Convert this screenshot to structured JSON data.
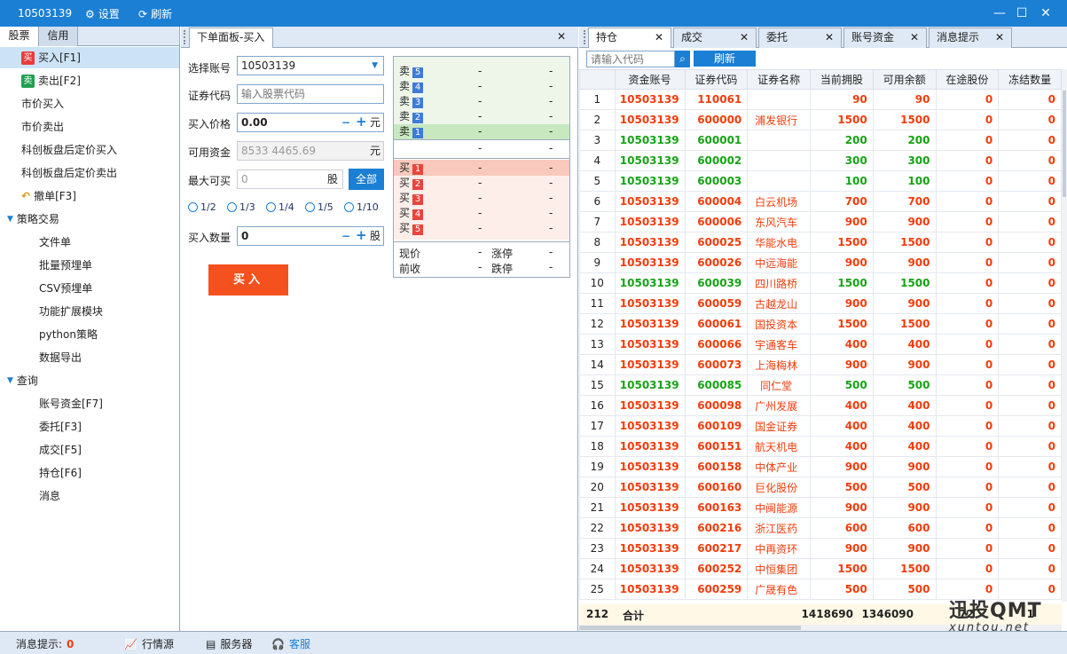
{
  "title": {
    "account": "10503139",
    "settings": "设置",
    "refresh": "刷新"
  },
  "left": {
    "tabs": [
      "股票",
      "信用"
    ],
    "items": [
      {
        "label": "买入[F1]",
        "badge": "买",
        "badge_color": "#e83c3c",
        "level": 1,
        "selected": true
      },
      {
        "label": "卖出[F2]",
        "badge": "卖",
        "badge_color": "#20a050",
        "level": 1
      },
      {
        "label": "市价买入",
        "level": 0
      },
      {
        "label": "市价卖出",
        "level": 0
      },
      {
        "label": "科创板盘后定价买入",
        "level": 0
      },
      {
        "label": "科创板盘后定价卖出",
        "level": 0
      },
      {
        "label": "撤单[F3]",
        "icon": "undo-icon",
        "level": 1
      },
      {
        "label": "策略交易",
        "caret": true,
        "level": 0
      },
      {
        "label": "文件单",
        "level": 2
      },
      {
        "label": "批量预埋单",
        "level": 2
      },
      {
        "label": "CSV预埋单",
        "level": 2
      },
      {
        "label": "功能扩展模块",
        "level": 2
      },
      {
        "label": "python策略",
        "level": 2
      },
      {
        "label": "数据导出",
        "level": 2
      },
      {
        "label": "查询",
        "caret": true,
        "level": 0
      },
      {
        "label": "账号资金[F7]",
        "level": 2
      },
      {
        "label": "委托[F3]",
        "level": 2
      },
      {
        "label": "成交[F5]",
        "level": 2
      },
      {
        "label": "持仓[F6]",
        "level": 2
      },
      {
        "label": "消息",
        "level": 2
      }
    ]
  },
  "order": {
    "tab": "下单面板-买入",
    "account_label": "选择账号",
    "account_value": "10503139",
    "code_label": "证券代码",
    "code_placeholder": "输入股票代码",
    "price_label": "买入价格",
    "price_value": "0.00",
    "price_unit": "元",
    "funds_label": "可用资金",
    "funds_value": "8533 4465.69",
    "funds_unit": "元",
    "max_label": "最大可买",
    "max_value": "0",
    "max_unit": "股",
    "all_btn": "全部",
    "ratios": [
      "1/2",
      "1/3",
      "1/4",
      "1/5",
      "1/10"
    ],
    "qty_label": "买入数量",
    "qty_value": "0",
    "qty_unit": "股",
    "minus": "−",
    "plus": "+",
    "buy_btn": "买入"
  },
  "book": {
    "sell": [
      {
        "l": "卖",
        "n": "5"
      },
      {
        "l": "卖",
        "n": "4"
      },
      {
        "l": "卖",
        "n": "3"
      },
      {
        "l": "卖",
        "n": "2"
      },
      {
        "l": "卖",
        "n": "1"
      }
    ],
    "buy": [
      {
        "l": "买",
        "n": "1"
      },
      {
        "l": "买",
        "n": "2"
      },
      {
        "l": "买",
        "n": "3"
      },
      {
        "l": "买",
        "n": "4"
      },
      {
        "l": "买",
        "n": "5"
      }
    ],
    "dash": "-",
    "now": "现价",
    "prev": "前收",
    "up": "涨停",
    "down": "跌停"
  },
  "right": {
    "tabs": [
      "持仓",
      "成交",
      "委托",
      "账号资金",
      "消息提示"
    ],
    "search_placeholder": "请输入代码",
    "refresh_btn": "刷新",
    "columns": [
      "资金账号",
      "证券代码",
      "证券名称",
      "当前拥股",
      "可用余额",
      "在途股份",
      "冻结数量"
    ],
    "rows": [
      {
        "i": "1",
        "a": "10503139",
        "c": "110061",
        "n": "",
        "h": "90",
        "v": "90",
        "t": "0",
        "f": "0",
        "g": false
      },
      {
        "i": "2",
        "a": "10503139",
        "c": "600000",
        "n": "浦发银行",
        "h": "1500",
        "v": "1500",
        "t": "0",
        "f": "0",
        "g": false
      },
      {
        "i": "3",
        "a": "10503139",
        "c": "600001",
        "n": "",
        "h": "200",
        "v": "200",
        "t": "0",
        "f": "0",
        "g": true
      },
      {
        "i": "4",
        "a": "10503139",
        "c": "600002",
        "n": "",
        "h": "300",
        "v": "300",
        "t": "0",
        "f": "0",
        "g": true
      },
      {
        "i": "5",
        "a": "10503139",
        "c": "600003",
        "n": "",
        "h": "100",
        "v": "100",
        "t": "0",
        "f": "0",
        "g": true
      },
      {
        "i": "6",
        "a": "10503139",
        "c": "600004",
        "n": "白云机场",
        "h": "700",
        "v": "700",
        "t": "0",
        "f": "0",
        "g": false
      },
      {
        "i": "7",
        "a": "10503139",
        "c": "600006",
        "n": "东风汽车",
        "h": "900",
        "v": "900",
        "t": "0",
        "f": "0",
        "g": false
      },
      {
        "i": "8",
        "a": "10503139",
        "c": "600025",
        "n": "华能水电",
        "h": "1500",
        "v": "1500",
        "t": "0",
        "f": "0",
        "g": false
      },
      {
        "i": "9",
        "a": "10503139",
        "c": "600026",
        "n": "中远海能",
        "h": "900",
        "v": "900",
        "t": "0",
        "f": "0",
        "g": false
      },
      {
        "i": "10",
        "a": "10503139",
        "c": "600039",
        "n": "四川路桥",
        "h": "1500",
        "v": "1500",
        "t": "0",
        "f": "0",
        "g": true
      },
      {
        "i": "11",
        "a": "10503139",
        "c": "600059",
        "n": "古越龙山",
        "h": "900",
        "v": "900",
        "t": "0",
        "f": "0",
        "g": false
      },
      {
        "i": "12",
        "a": "10503139",
        "c": "600061",
        "n": "国投资本",
        "h": "1500",
        "v": "1500",
        "t": "0",
        "f": "0",
        "g": false
      },
      {
        "i": "13",
        "a": "10503139",
        "c": "600066",
        "n": "宇通客车",
        "h": "400",
        "v": "400",
        "t": "0",
        "f": "0",
        "g": false
      },
      {
        "i": "14",
        "a": "10503139",
        "c": "600073",
        "n": "上海梅林",
        "h": "900",
        "v": "900",
        "t": "0",
        "f": "0",
        "g": false
      },
      {
        "i": "15",
        "a": "10503139",
        "c": "600085",
        "n": "同仁堂",
        "h": "500",
        "v": "500",
        "t": "0",
        "f": "0",
        "g": true
      },
      {
        "i": "16",
        "a": "10503139",
        "c": "600098",
        "n": "广州发展",
        "h": "400",
        "v": "400",
        "t": "0",
        "f": "0",
        "g": false
      },
      {
        "i": "17",
        "a": "10503139",
        "c": "600109",
        "n": "国金证券",
        "h": "400",
        "v": "400",
        "t": "0",
        "f": "0",
        "g": false
      },
      {
        "i": "18",
        "a": "10503139",
        "c": "600151",
        "n": "航天机电",
        "h": "400",
        "v": "400",
        "t": "0",
        "f": "0",
        "g": false
      },
      {
        "i": "19",
        "a": "10503139",
        "c": "600158",
        "n": "中体产业",
        "h": "900",
        "v": "900",
        "t": "0",
        "f": "0",
        "g": false
      },
      {
        "i": "20",
        "a": "10503139",
        "c": "600160",
        "n": "巨化股份",
        "h": "500",
        "v": "500",
        "t": "0",
        "f": "0",
        "g": false
      },
      {
        "i": "21",
        "a": "10503139",
        "c": "600163",
        "n": "中闽能源",
        "h": "900",
        "v": "900",
        "t": "0",
        "f": "0",
        "g": false
      },
      {
        "i": "22",
        "a": "10503139",
        "c": "600216",
        "n": "浙江医药",
        "h": "600",
        "v": "600",
        "t": "0",
        "f": "0",
        "g": false
      },
      {
        "i": "23",
        "a": "10503139",
        "c": "600217",
        "n": "中再资环",
        "h": "900",
        "v": "900",
        "t": "0",
        "f": "0",
        "g": false
      },
      {
        "i": "24",
        "a": "10503139",
        "c": "600252",
        "n": "中恒集团",
        "h": "1500",
        "v": "1500",
        "t": "0",
        "f": "0",
        "g": false
      },
      {
        "i": "25",
        "a": "10503139",
        "c": "600259",
        "n": "广晟有色",
        "h": "500",
        "v": "500",
        "t": "0",
        "f": "0",
        "g": false
      }
    ],
    "total": {
      "count": "212",
      "label": "合计",
      "h": "1418690",
      "v": "1346090",
      "t": "72",
      "f": "1"
    }
  },
  "status": {
    "msg_label": "消息提示:",
    "msg_count": "0",
    "market": "行情源",
    "server": "服务器",
    "service": "客服"
  },
  "watermark": {
    "big": "迅投QMT",
    "small": "xuntou.net"
  }
}
